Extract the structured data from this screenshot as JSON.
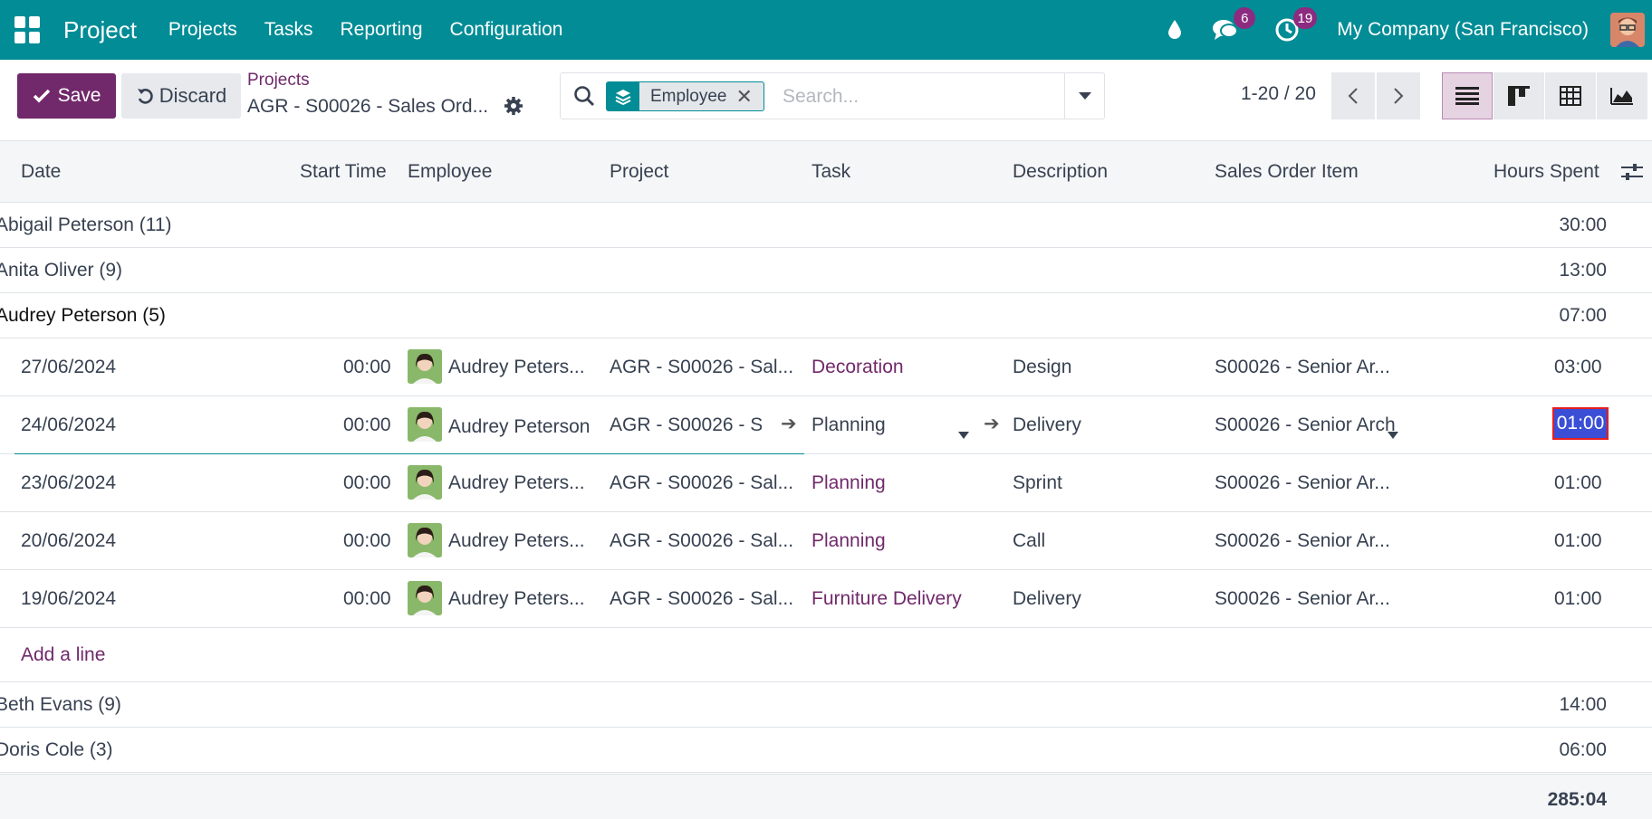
{
  "navbar": {
    "brand": "Project",
    "menu": [
      "Projects",
      "Tasks",
      "Reporting",
      "Configuration"
    ],
    "messages_badge": "6",
    "activities_badge": "19",
    "company": "My Company (San Francisco)"
  },
  "toolbar": {
    "save_label": "Save",
    "discard_label": "Discard"
  },
  "breadcrumb": {
    "parent": "Projects",
    "current": "AGR - S00026 - Sales Ord..."
  },
  "search": {
    "facet_label": "Employee",
    "facet_remove": "✕",
    "placeholder": "Search..."
  },
  "pager": {
    "value": "1-20 / 20"
  },
  "table": {
    "headers": {
      "date": "Date",
      "start_time": "Start Time",
      "employee": "Employee",
      "project": "Project",
      "task": "Task",
      "description": "Description",
      "sales_order_item": "Sales Order Item",
      "hours_spent": "Hours Spent"
    },
    "groups_top": [
      {
        "name": "Abigail Peterson (11)",
        "hours": "30:00"
      },
      {
        "name": "Anita Oliver (9)",
        "hours": "13:00"
      },
      {
        "name": "Audrey Peterson (5)",
        "hours": "07:00"
      }
    ],
    "rows": [
      {
        "date": "27/06/2024",
        "start": "00:00",
        "employee": "Audrey Peters...",
        "project": "AGR - S00026 - Sal...",
        "task": "Decoration",
        "description": "Design",
        "so_item": "S00026 - Senior Ar...",
        "hours": "03:00"
      },
      {
        "date": "24/06/2024",
        "start": "00:00",
        "employee": "Audrey Peterson",
        "project": "AGR - S00026 - S",
        "task": "Planning",
        "description": "Delivery",
        "so_item": "S00026 - Senior Arch",
        "hours": "01:00"
      },
      {
        "date": "23/06/2024",
        "start": "00:00",
        "employee": "Audrey Peters...",
        "project": "AGR - S00026 - Sal...",
        "task": "Planning",
        "description": "Sprint",
        "so_item": "S00026 - Senior Ar...",
        "hours": "01:00"
      },
      {
        "date": "20/06/2024",
        "start": "00:00",
        "employee": "Audrey Peters...",
        "project": "AGR - S00026 - Sal...",
        "task": "Planning",
        "description": "Call",
        "so_item": "S00026 - Senior Ar...",
        "hours": "01:00"
      },
      {
        "date": "19/06/2024",
        "start": "00:00",
        "employee": "Audrey Peters...",
        "project": "AGR - S00026 - Sal...",
        "task": "Furniture Delivery",
        "description": "Delivery",
        "so_item": "S00026 - Senior Ar...",
        "hours": "01:00"
      }
    ],
    "add_line": "Add a line",
    "groups_bottom": [
      {
        "name": "Beth Evans (9)",
        "hours": "14:00"
      },
      {
        "name": "Doris Cole (3)",
        "hours": "06:00"
      }
    ],
    "total": "285:04"
  },
  "colors": {
    "navbar": "#018c96",
    "primary": "#71296b",
    "badge": "#8c2b7f",
    "selection": "#3b4fd6"
  }
}
